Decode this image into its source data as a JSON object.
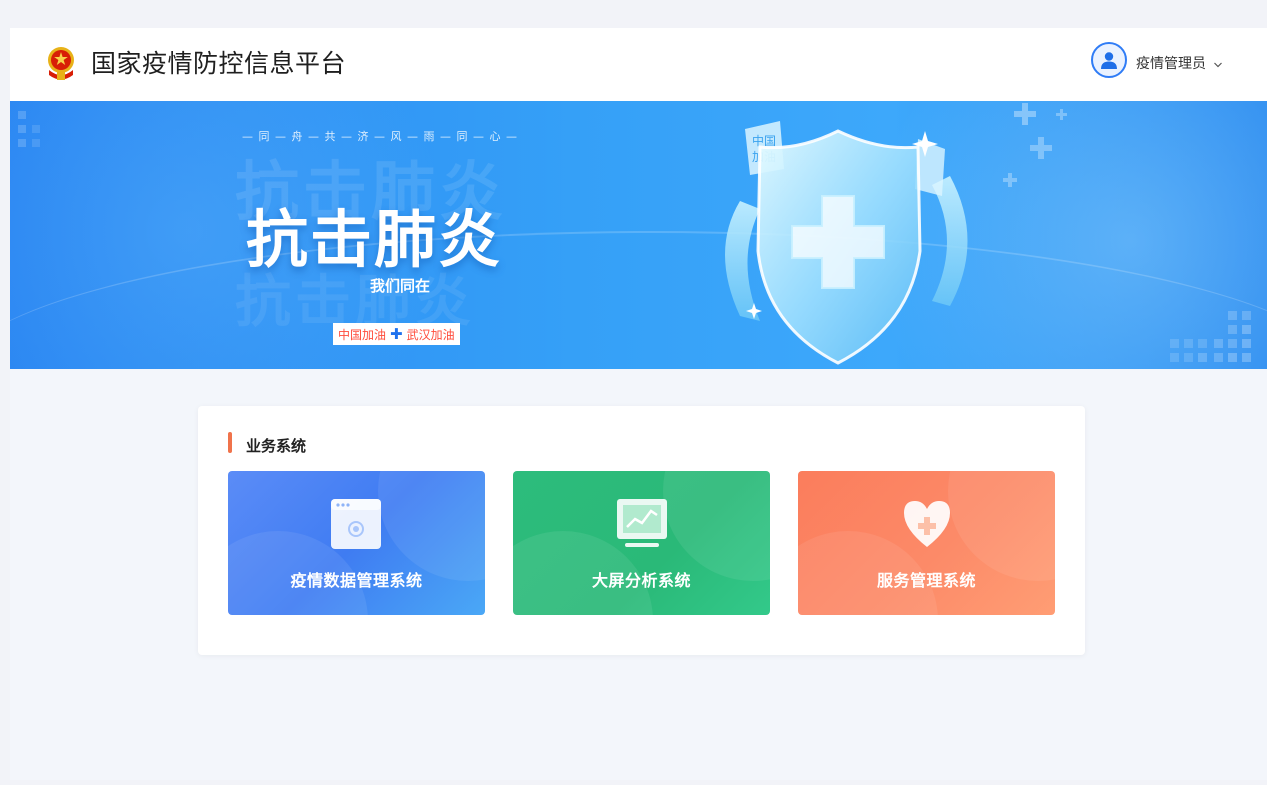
{
  "header": {
    "title": "国家疫情防控信息平台",
    "emblem_icon": "national-emblem-icon",
    "user": {
      "name": "疫情管理员",
      "avatar_icon": "user-avatar-icon",
      "dropdown_icon": "chevron-down-icon"
    }
  },
  "banner": {
    "slogan_line": "— 同 — 舟 — 共 — 济 — 风 — 雨 — 同 — 心 —",
    "headline": "抗击肺炎",
    "subtitle": "我们同在",
    "tag_left": "中国加油",
    "tag_right": "武汉加油",
    "shield_note_1": "中国加油",
    "colors": {
      "primary": "#2a86f2",
      "tag_text": "#ff4c3b"
    }
  },
  "section": {
    "title": "业务系统",
    "accent": "#f0734b",
    "tiles": [
      {
        "label": "疫情数据管理系统",
        "icon": "browser-window-icon",
        "color": "#4a82f4"
      },
      {
        "label": "大屏分析系统",
        "icon": "monitor-chart-icon",
        "color": "#2dbc7c"
      },
      {
        "label": "服务管理系统",
        "icon": "heart-plus-icon",
        "color": "#fb8461"
      }
    ]
  }
}
